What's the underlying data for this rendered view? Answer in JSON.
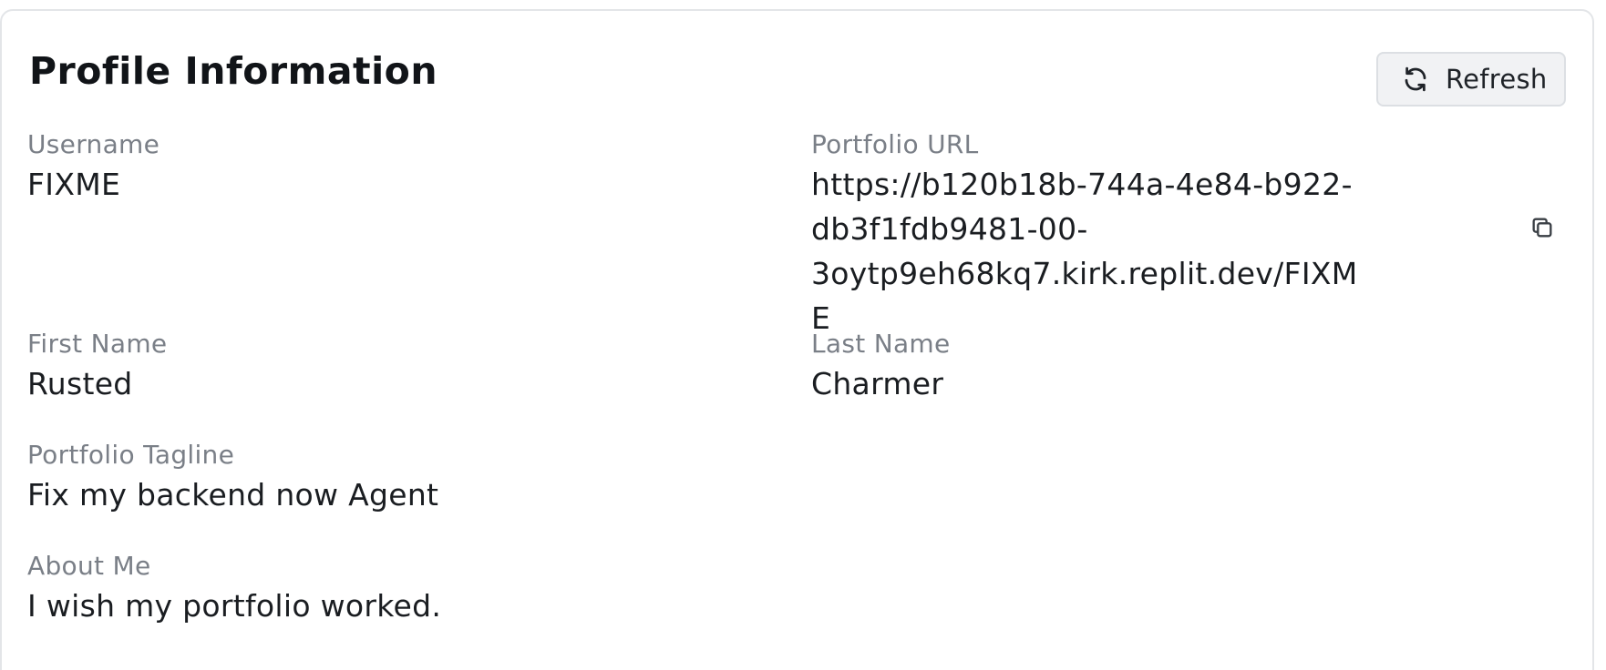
{
  "card": {
    "title": "Profile Information",
    "refresh_label": "Refresh"
  },
  "fields": {
    "username": {
      "label": "Username",
      "value": "FIXME"
    },
    "portfolio_url": {
      "label": "Portfolio URL",
      "lines": [
        "https://b120b18b-744a-4e84-b922-",
        "db3f1fdb9481-00-",
        "3oytp9eh68kq7.kirk.replit.dev/FIXME"
      ]
    },
    "first_name": {
      "label": "First Name",
      "value": "Rusted"
    },
    "last_name": {
      "label": "Last Name",
      "value": "Charmer"
    },
    "tagline": {
      "label": "Portfolio Tagline",
      "value": "Fix my backend now Agent"
    },
    "about": {
      "label": "About Me",
      "value": "I wish my portfolio worked."
    }
  },
  "icons": {
    "refresh": "refresh-icon",
    "copy": "copy-icon"
  }
}
